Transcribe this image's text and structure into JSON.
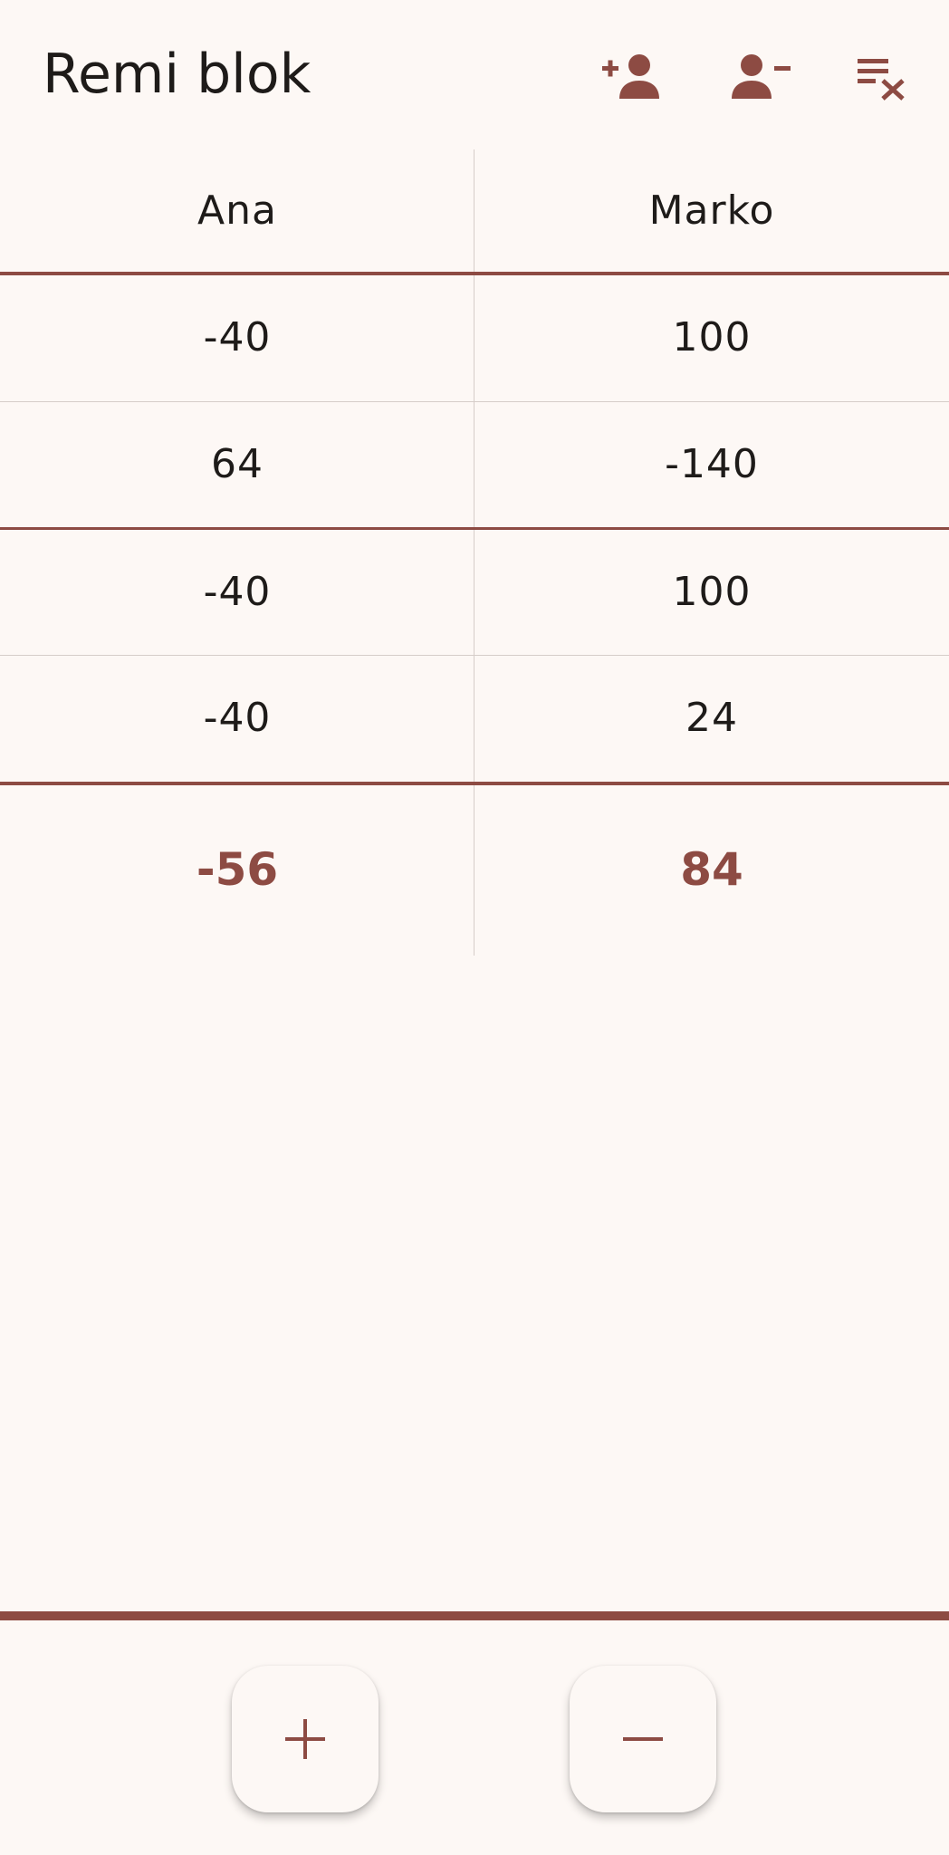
{
  "app_bar": {
    "title": "Remi blok",
    "actions": [
      {
        "icon": "person-add-icon"
      },
      {
        "icon": "person-remove-icon"
      },
      {
        "icon": "clear-list-icon"
      }
    ]
  },
  "players": [
    "Ana",
    "Marko"
  ],
  "rounds": [
    [
      "-40",
      "100"
    ],
    [
      "64",
      "-140"
    ],
    [
      "-40",
      "100"
    ],
    [
      "-40",
      "24"
    ]
  ],
  "totals": [
    "-56",
    "84"
  ],
  "fabs": {
    "add_icon": "plus-icon",
    "subtract_icon": "minus-icon"
  },
  "colors": {
    "accent": "#8d4b43",
    "background": "#fdf8f5",
    "text": "#1e1b19",
    "divider": "#d6cdc9"
  }
}
